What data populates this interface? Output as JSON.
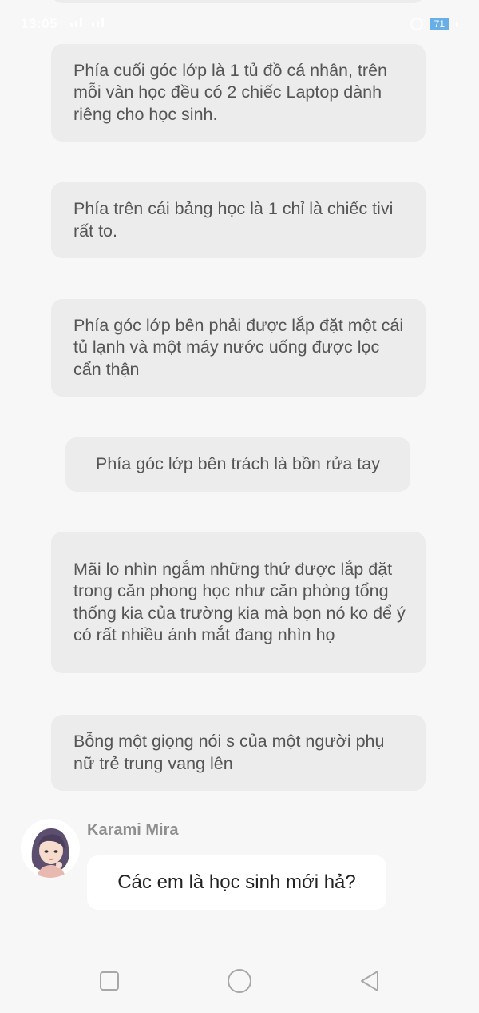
{
  "status_bar": {
    "time": "13:05",
    "battery": "71"
  },
  "messages": [
    "Phía cuối góc lớp là 1 tủ đồ cá nhân, trên mỗi vàn học đều có 2 chiếc Laptop dành riêng cho học sinh.",
    "Phía trên cái bảng học là 1 chỉ là chiếc tivi rất to.",
    "Phía góc lớp bên phải được lắp đặt một cái tủ lạnh và một máy nước uống được lọc cẩn thận",
    "Phía góc lớp bên trách là bồn rửa tay",
    "Mãi lo nhìn ngắm những thứ được lắp đặt trong căn phong học như căn phòng tổng thống kia của trường kia mà bọn nó ko để ý có rất nhiều ánh mắt đang nhìn họ",
    "Bỗng một giọng nói s của một người phụ nữ trẻ trung vang lên"
  ],
  "dialog": {
    "speaker": "Karami Mira",
    "text": "Các em là học sinh mới hả?"
  },
  "icons": {
    "recent": "square-recent-apps-icon",
    "home": "circle-home-icon",
    "back": "triangle-back-icon"
  }
}
